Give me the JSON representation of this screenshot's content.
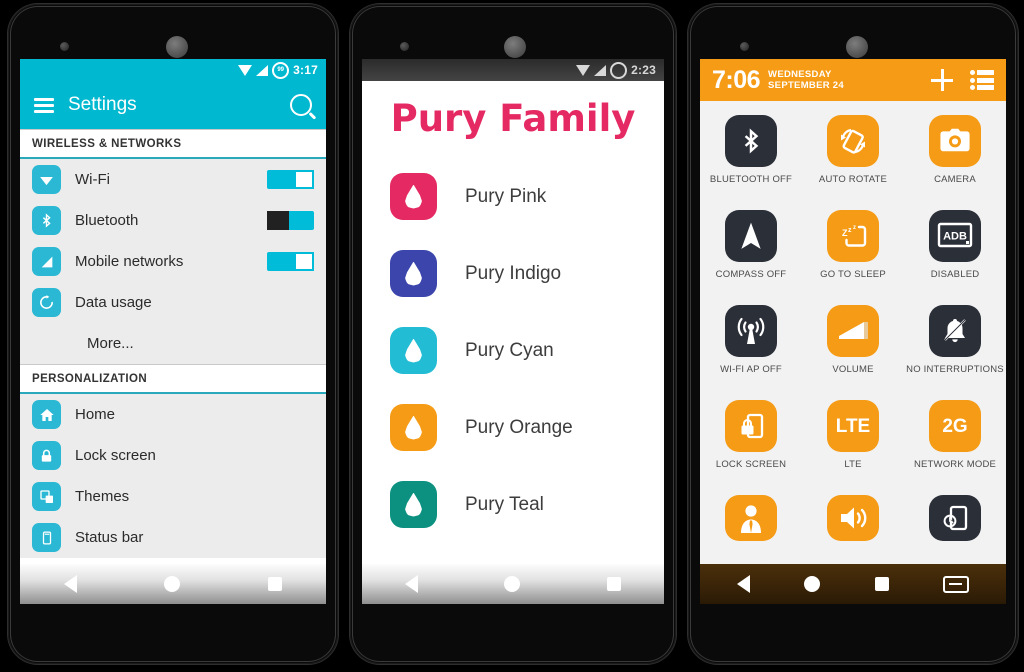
{
  "phone1": {
    "status": {
      "time": "3:17",
      "battery": "99",
      "icons": [
        "wifi-icon",
        "signal-icon",
        "battery-icon"
      ]
    },
    "appbar": {
      "title": "Settings",
      "menu_icon": "hamburger-icon",
      "search_icon": "search-icon"
    },
    "sections": [
      {
        "header": "WIRELESS & NETWORKS",
        "items": [
          {
            "label": "Wi-Fi",
            "icon": "wifi-icon",
            "toggle": "on"
          },
          {
            "label": "Bluetooth",
            "icon": "bluetooth-icon",
            "toggle": "off"
          },
          {
            "label": "Mobile networks",
            "icon": "signal-icon",
            "toggle": "on"
          },
          {
            "label": "Data usage",
            "icon": "data-usage-icon",
            "toggle": "none"
          },
          {
            "label": "More...",
            "icon": "none",
            "toggle": "none"
          }
        ]
      },
      {
        "header": "PERSONALIZATION",
        "items": [
          {
            "label": "Home",
            "icon": "home-icon",
            "toggle": "none"
          },
          {
            "label": "Lock screen",
            "icon": "lock-icon",
            "toggle": "none"
          },
          {
            "label": "Themes",
            "icon": "themes-icon",
            "toggle": "none"
          },
          {
            "label": "Status bar",
            "icon": "status-bar-icon",
            "toggle": "none"
          }
        ]
      }
    ],
    "navbar": [
      "back-icon",
      "home-icon",
      "recents-icon"
    ],
    "accent": "#00b8cf"
  },
  "phone2": {
    "status": {
      "time": "2:23",
      "icons": [
        "wifi-icon",
        "signal-icon",
        "battery-icon"
      ]
    },
    "title": "Pury Family",
    "title_color": "#e52a63",
    "items": [
      {
        "label": "Pury Pink",
        "color": "#e52a63",
        "icon": "droplet-icon"
      },
      {
        "label": "Pury Indigo",
        "color": "#3b45ab",
        "icon": "droplet-icon"
      },
      {
        "label": "Pury Cyan",
        "color": "#22bcd4",
        "icon": "droplet-icon"
      },
      {
        "label": "Pury Orange",
        "color": "#f59b16",
        "icon": "droplet-icon"
      },
      {
        "label": "Pury Teal",
        "color": "#0c9181",
        "icon": "droplet-icon"
      }
    ],
    "navbar": [
      "back-icon",
      "home-icon",
      "recents-icon"
    ]
  },
  "phone3": {
    "header": {
      "clock": "7:06",
      "day": "WEDNESDAY",
      "date": "SEPTEMBER 24",
      "add_icon": "plus-icon",
      "list_icon": "list-icon",
      "bg": "#f59b16"
    },
    "tiles": [
      {
        "label": "BLUETOOTH OFF",
        "icon": "bluetooth-icon",
        "state": "dark",
        "glyph": ""
      },
      {
        "label": "AUTO ROTATE",
        "icon": "auto-rotate-icon",
        "state": "orange",
        "glyph": ""
      },
      {
        "label": "CAMERA",
        "icon": "camera-icon",
        "state": "orange",
        "glyph": ""
      },
      {
        "label": "COMPASS OFF",
        "icon": "compass-icon",
        "state": "dark",
        "glyph": ""
      },
      {
        "label": "GO TO SLEEP",
        "icon": "sleep-icon",
        "state": "orange",
        "glyph": ""
      },
      {
        "label": "DISABLED",
        "icon": "adb-icon",
        "state": "dark",
        "glyph": "ADB"
      },
      {
        "label": "WI-FI AP OFF",
        "icon": "wifi-hotspot-icon",
        "state": "dark",
        "glyph": ""
      },
      {
        "label": "VOLUME",
        "icon": "volume-icon",
        "state": "orange",
        "glyph": ""
      },
      {
        "label": "NO INTERRUPTIONS",
        "icon": "bell-off-icon",
        "state": "dark",
        "glyph": ""
      },
      {
        "label": "LOCK SCREEN",
        "icon": "lock-screen-icon",
        "state": "orange",
        "glyph": ""
      },
      {
        "label": "LTE",
        "icon": "lte-icon",
        "state": "orange",
        "glyph": "LTE"
      },
      {
        "label": "NETWORK MODE",
        "icon": "network-mode-icon",
        "state": "orange",
        "glyph": "2G"
      },
      {
        "label": "",
        "icon": "user-icon",
        "state": "orange",
        "glyph": ""
      },
      {
        "label": "",
        "icon": "sound-icon",
        "state": "orange",
        "glyph": ""
      },
      {
        "label": "",
        "icon": "screen-timeout-icon",
        "state": "dark",
        "glyph": ""
      }
    ],
    "navbar": [
      "back-icon",
      "home-icon",
      "recents-icon",
      "menu-icon"
    ]
  }
}
